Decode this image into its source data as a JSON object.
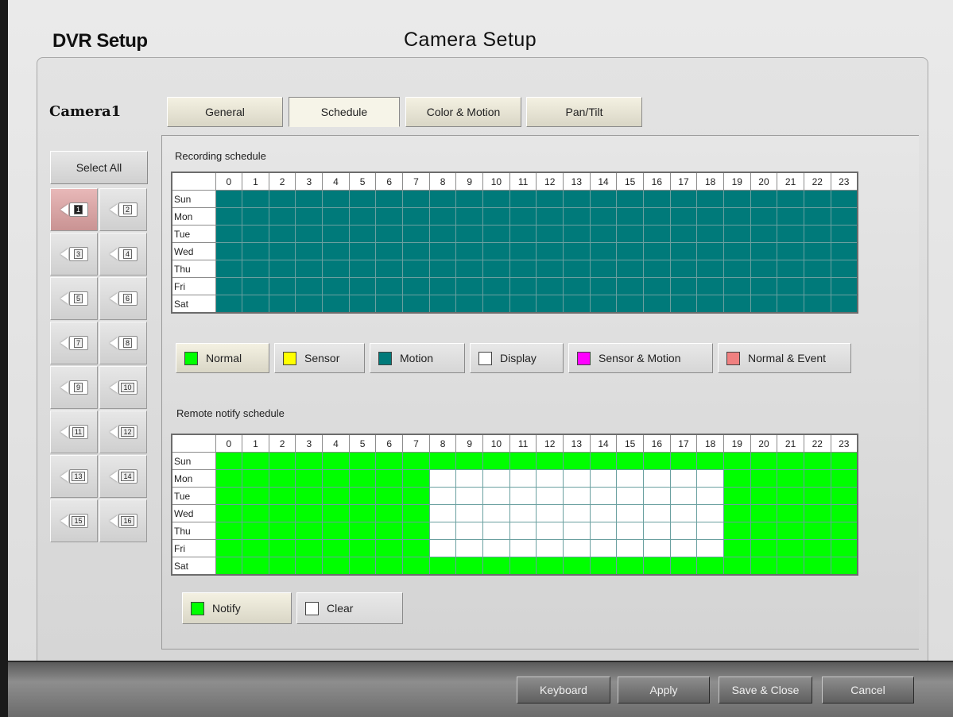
{
  "header": {
    "app_title": "DVR Setup",
    "page_title": "Camera Setup"
  },
  "camera": {
    "name": "Camera1",
    "select_all_label": "Select All",
    "buttons": [
      "1",
      "2",
      "3",
      "4",
      "5",
      "6",
      "7",
      "8",
      "9",
      "10",
      "11",
      "12",
      "13",
      "14",
      "15",
      "16"
    ],
    "selected": "1"
  },
  "tabs": [
    {
      "label": "General"
    },
    {
      "label": "Schedule",
      "active": true
    },
    {
      "label": "Color & Motion"
    },
    {
      "label": "Pan/Tilt"
    }
  ],
  "hours": [
    "0",
    "1",
    "2",
    "3",
    "4",
    "5",
    "6",
    "7",
    "8",
    "9",
    "10",
    "11",
    "12",
    "13",
    "14",
    "15",
    "16",
    "17",
    "18",
    "19",
    "20",
    "21",
    "22",
    "23"
  ],
  "days": [
    "Sun",
    "Mon",
    "Tue",
    "Wed",
    "Thu",
    "Fri",
    "Sat"
  ],
  "colors": {
    "normal": "#00ff00",
    "sensor": "#ffff00",
    "motion": "#007a7a",
    "display": "#ffffff",
    "sensor_motion": "#ff00ff",
    "normal_event": "#f08080",
    "notify": "#00ff00",
    "clear": "#ffffff"
  },
  "recording": {
    "label": "Recording schedule",
    "fill": "motion",
    "legend": [
      {
        "label": "Normal",
        "color": "#00ff00"
      },
      {
        "label": "Sensor",
        "color": "#ffff00"
      },
      {
        "label": "Motion",
        "color": "#007a7a"
      },
      {
        "label": "Display",
        "color": "#ffffff"
      },
      {
        "label": "Sensor & Motion",
        "color": "#ff00ff"
      },
      {
        "label": "Normal & Event",
        "color": "#f08080"
      }
    ]
  },
  "notify": {
    "label": "Remote notify schedule",
    "fill": "notify",
    "clear_region": {
      "days": [
        "Mon",
        "Tue",
        "Wed",
        "Thu",
        "Fri"
      ],
      "hours_from": 8,
      "hours_to": 18
    },
    "legend": [
      {
        "label": "Notify",
        "color": "#00ff00"
      },
      {
        "label": "Clear",
        "color": "#ffffff"
      }
    ]
  },
  "footer": {
    "keyboard": "Keyboard",
    "apply": "Apply",
    "save_close": "Save & Close",
    "cancel": "Cancel"
  }
}
